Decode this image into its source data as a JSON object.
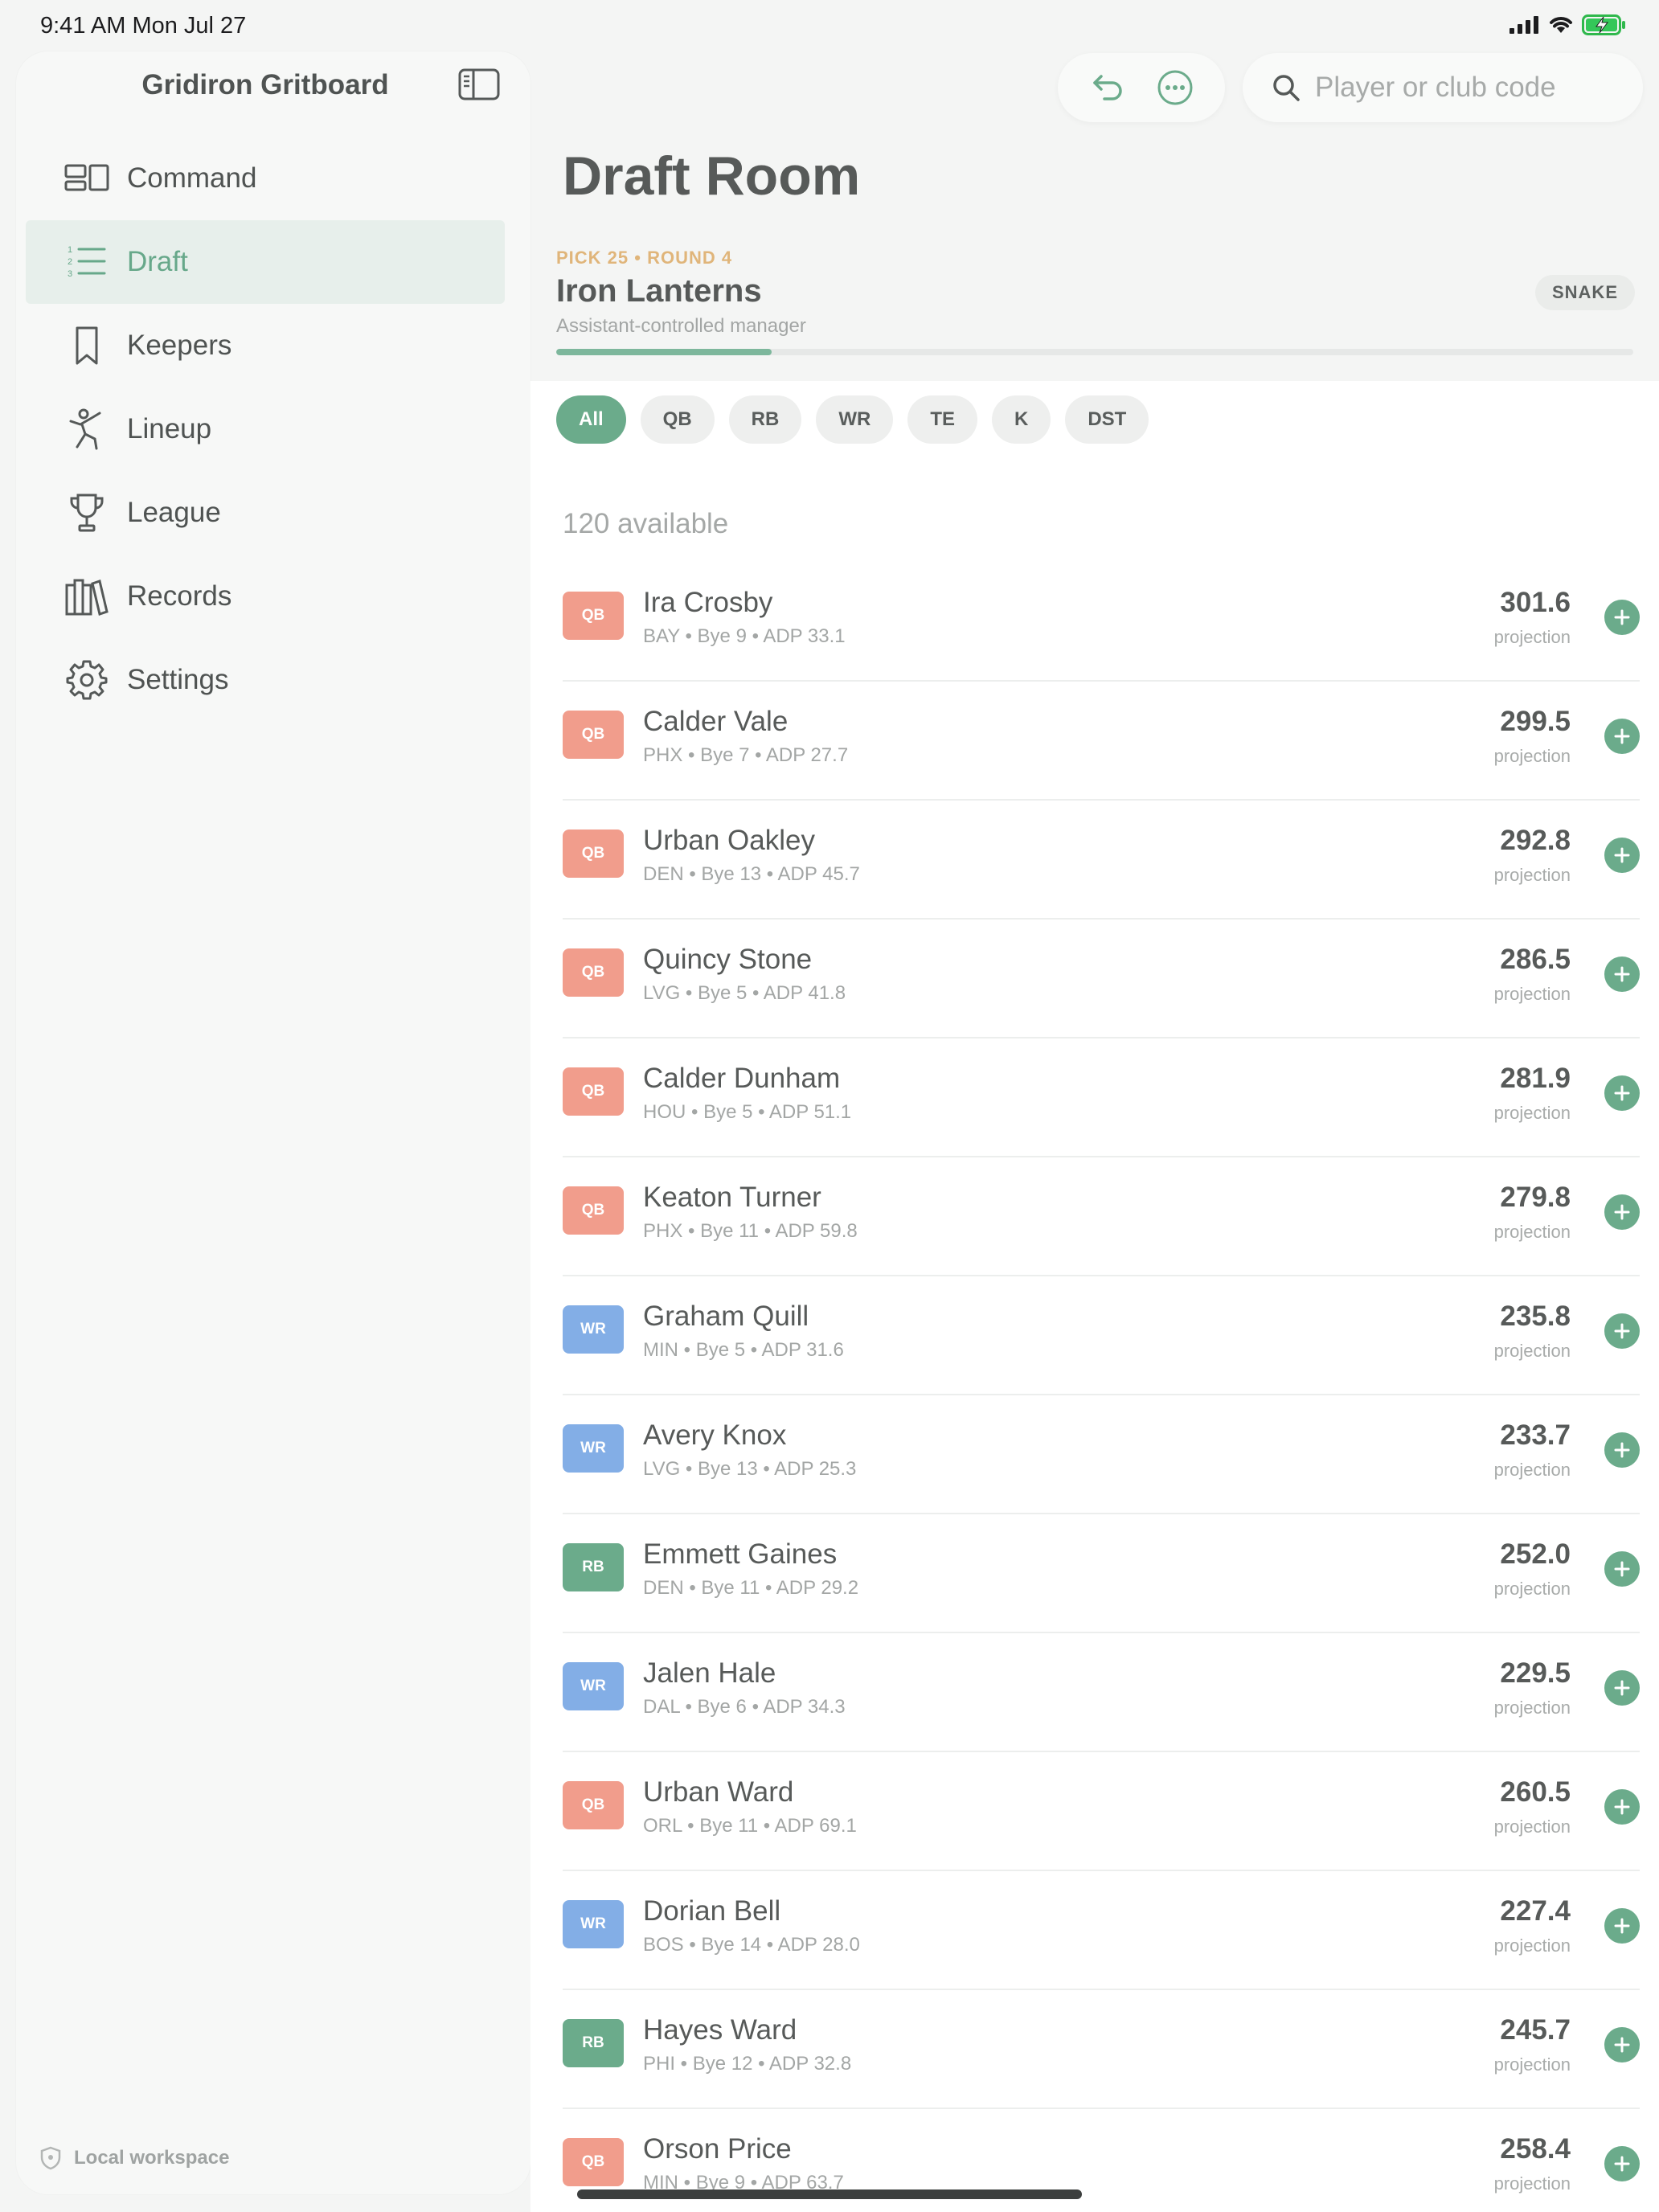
{
  "status_bar": {
    "time": "9:41 AM   Mon Jul 27"
  },
  "app": {
    "title": "Gridiron Gritboard"
  },
  "sidebar": {
    "items": [
      {
        "label": "Command",
        "icon": "command-icon",
        "active": false
      },
      {
        "label": "Draft",
        "icon": "list-numbered-icon",
        "active": true
      },
      {
        "label": "Keepers",
        "icon": "bookmark-icon",
        "active": false
      },
      {
        "label": "Lineup",
        "icon": "runner-icon",
        "active": false
      },
      {
        "label": "League",
        "icon": "trophy-icon",
        "active": false
      },
      {
        "label": "Records",
        "icon": "books-icon",
        "active": false
      },
      {
        "label": "Settings",
        "icon": "gear-icon",
        "active": false
      }
    ],
    "footer": "Local workspace"
  },
  "search": {
    "placeholder": "Player or club code"
  },
  "page": {
    "title": "Draft Room"
  },
  "pick": {
    "label": "PICK 25 • ROUND 4",
    "team": "Iron Lanterns",
    "subtitle": "Assistant-controlled manager",
    "mode": "SNAKE",
    "progress": 0.2
  },
  "filters": [
    "All",
    "QB",
    "RB",
    "WR",
    "TE",
    "K",
    "DST"
  ],
  "available": "120 available",
  "projection_label": "projection",
  "colors": {
    "accent": "#6bab8b",
    "QB": "#f19d8c",
    "WR": "#83aee6",
    "RB": "#6bab8b",
    "pick_label": "#e0b57a"
  },
  "players": [
    {
      "pos": "QB",
      "name": "Ira Crosby",
      "meta": "BAY • Bye 9 • ADP 33.1",
      "proj": "301.6"
    },
    {
      "pos": "QB",
      "name": "Calder Vale",
      "meta": "PHX • Bye 7 • ADP 27.7",
      "proj": "299.5"
    },
    {
      "pos": "QB",
      "name": "Urban Oakley",
      "meta": "DEN • Bye 13 • ADP 45.7",
      "proj": "292.8"
    },
    {
      "pos": "QB",
      "name": "Quincy Stone",
      "meta": "LVG • Bye 5 • ADP 41.8",
      "proj": "286.5"
    },
    {
      "pos": "QB",
      "name": "Calder Dunham",
      "meta": "HOU • Bye 5 • ADP 51.1",
      "proj": "281.9"
    },
    {
      "pos": "QB",
      "name": "Keaton Turner",
      "meta": "PHX • Bye 11 • ADP 59.8",
      "proj": "279.8"
    },
    {
      "pos": "WR",
      "name": "Graham Quill",
      "meta": "MIN • Bye 5 • ADP 31.6",
      "proj": "235.8"
    },
    {
      "pos": "WR",
      "name": "Avery Knox",
      "meta": "LVG • Bye 13 • ADP 25.3",
      "proj": "233.7"
    },
    {
      "pos": "RB",
      "name": "Emmett Gaines",
      "meta": "DEN • Bye 11 • ADP 29.2",
      "proj": "252.0"
    },
    {
      "pos": "WR",
      "name": "Jalen Hale",
      "meta": "DAL • Bye 6 • ADP 34.3",
      "proj": "229.5"
    },
    {
      "pos": "QB",
      "name": "Urban Ward",
      "meta": "ORL • Bye 11 • ADP 69.1",
      "proj": "260.5"
    },
    {
      "pos": "WR",
      "name": "Dorian Bell",
      "meta": "BOS • Bye 14 • ADP 28.0",
      "proj": "227.4"
    },
    {
      "pos": "RB",
      "name": "Hayes Ward",
      "meta": "PHI • Bye 12 • ADP 32.8",
      "proj": "245.7"
    },
    {
      "pos": "QB",
      "name": "Orson Price",
      "meta": "MIN • Bye 9 • ADP 63.7",
      "proj": "258.4"
    }
  ]
}
